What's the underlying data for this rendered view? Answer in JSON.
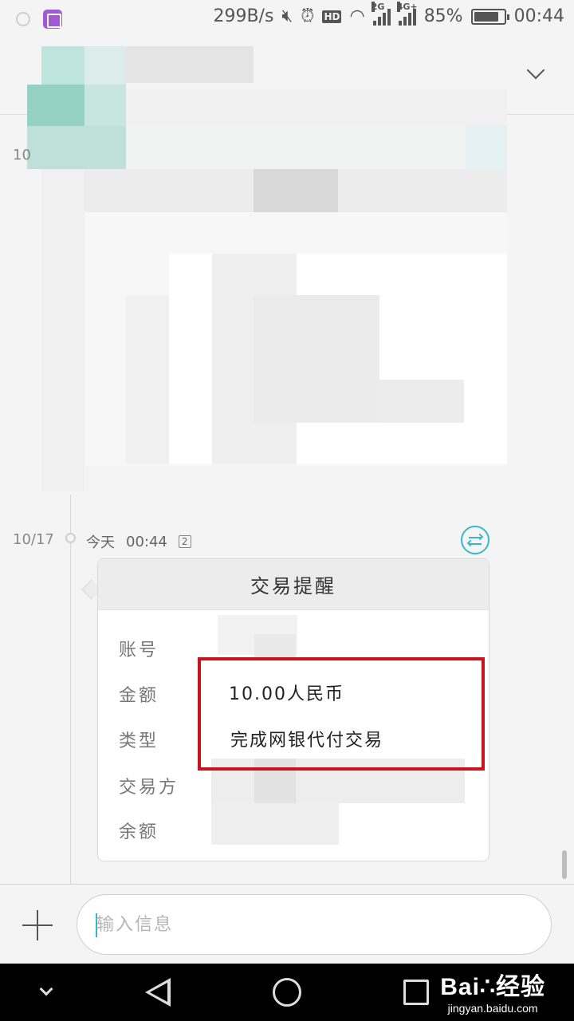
{
  "status_bar": {
    "net_speed": "299B/s",
    "sim1_type": "2G",
    "sim2_type": "4G+",
    "battery_percent": "85%",
    "battery_level": 0.85,
    "time": "00:44",
    "icons": [
      "mute-icon",
      "alarm-icon",
      "hd-icon",
      "wifi-icon",
      "signal-icon"
    ]
  },
  "conversation": {
    "earlier_date": "10",
    "date": "10/17",
    "meta_day": "今天",
    "meta_time": "00:44",
    "meta_count": "2"
  },
  "card": {
    "title": "交易提醒",
    "rows": {
      "account_label": "账号",
      "amount_label": "金额",
      "type_label": "类型",
      "counterparty_label": "交易方",
      "balance_label": "余额"
    },
    "amount_value": "10.00人民币",
    "type_value": "完成网银代付交易"
  },
  "input": {
    "placeholder": "输入信息"
  },
  "watermark": {
    "logo": "Bai∴经验",
    "url": "jingyan.baidu.com"
  },
  "colors": {
    "accent": "#35b9c9",
    "highlight": "#c8131c"
  }
}
